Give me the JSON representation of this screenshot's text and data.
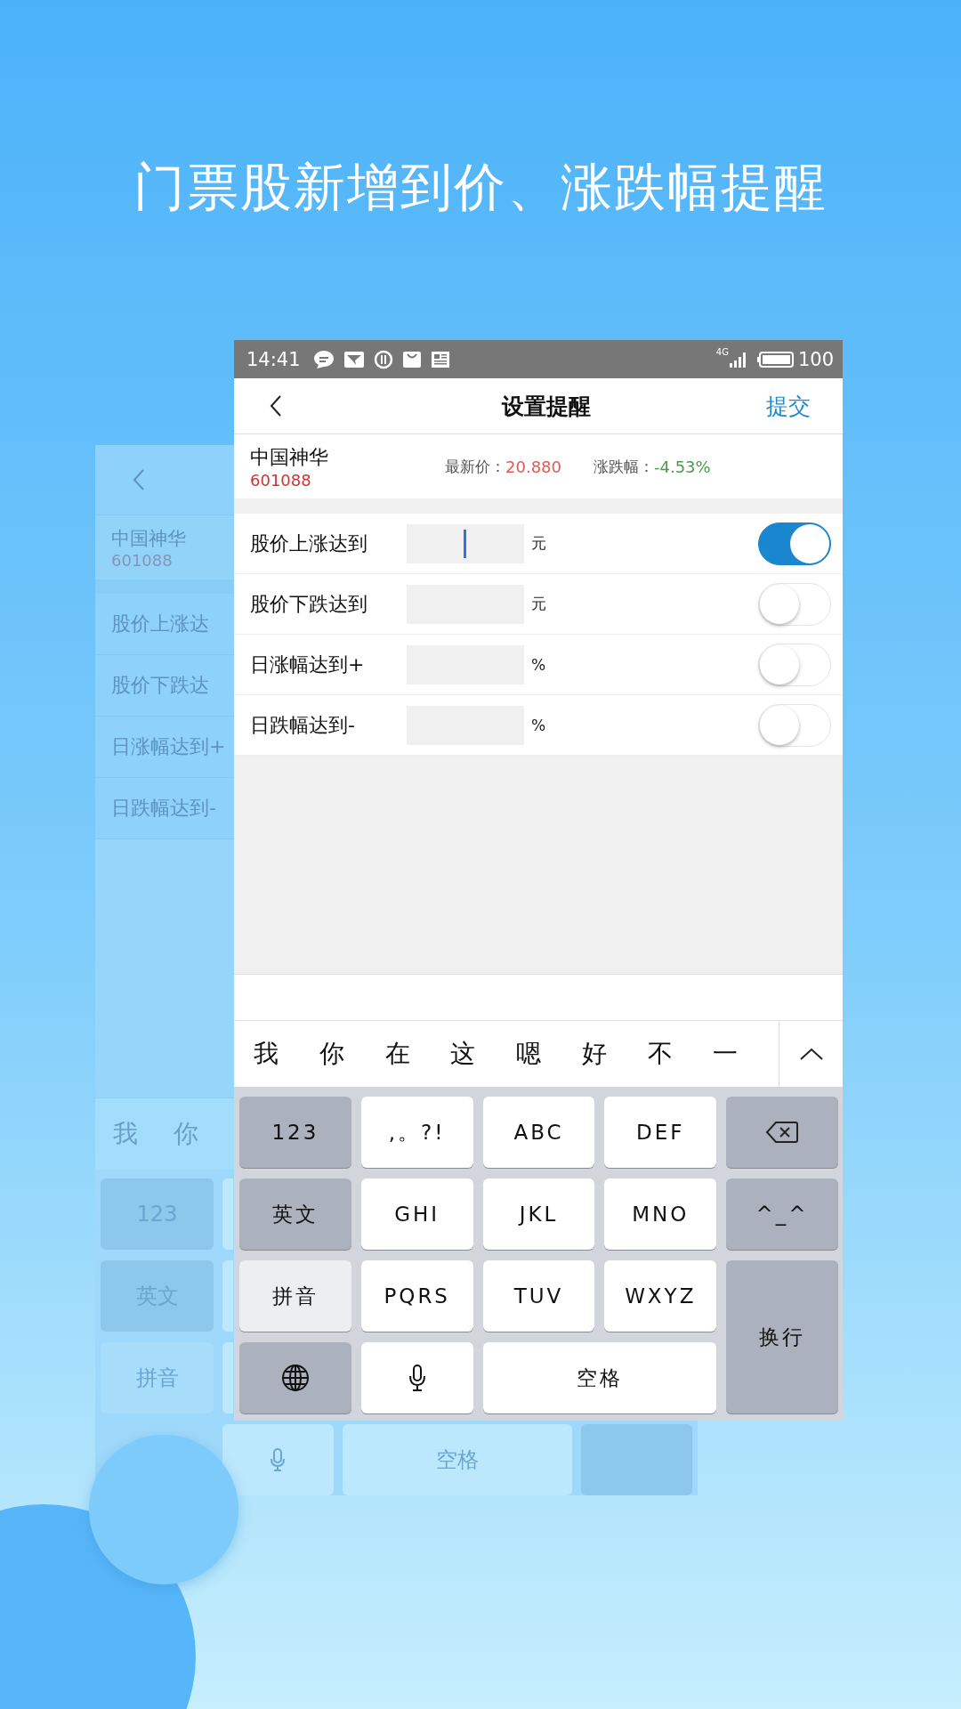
{
  "headline": "门票股新增到价、涨跌幅提醒",
  "background_screen": {
    "stock": {
      "name": "中国神华",
      "code": "601088"
    },
    "rows": [
      "股价上涨达",
      "股价下跌达",
      "日涨幅达到+",
      "日跌幅达到-"
    ],
    "candidates": [
      "我",
      "你"
    ],
    "key_rows": [
      [
        {
          "kind": "function",
          "label": "123"
        },
        {
          "kind": "partial"
        }
      ],
      [
        {
          "kind": "function",
          "label": "英文"
        },
        {
          "kind": "partial"
        }
      ],
      [
        {
          "kind": "active",
          "label": "拼音"
        },
        {
          "kind": "partial"
        }
      ],
      [
        {
          "kind": "gap"
        },
        {
          "kind": "mic"
        },
        {
          "kind": "space",
          "label": "空格"
        },
        {
          "kind": "function"
        }
      ]
    ]
  },
  "screen": {
    "status_bar": {
      "time": "14:41",
      "network": "4G",
      "battery": "100"
    },
    "header": {
      "title": "设置提醒",
      "action": "提交"
    },
    "stock": {
      "name": "中国神华",
      "code": "601088",
      "price_label": "最新价：",
      "price": "20.880",
      "change_label": "涨跌幅：",
      "change": "-4.53%"
    },
    "alerts": [
      {
        "label": "股价上涨达到",
        "unit": "元",
        "focused": true,
        "on": true
      },
      {
        "label": "股价下跌达到",
        "unit": "元",
        "focused": false,
        "on": false
      },
      {
        "label": "日涨幅达到+",
        "unit": "%",
        "focused": false,
        "on": false
      },
      {
        "label": "日跌幅达到-",
        "unit": "%",
        "focused": false,
        "on": false
      }
    ],
    "candidates": [
      "我",
      "你",
      "在",
      "这",
      "嗯",
      "好",
      "不",
      "一"
    ],
    "keys": [
      {
        "kind": "function",
        "label": "123"
      },
      {
        "kind": "char",
        "label": ",。?!"
      },
      {
        "kind": "char",
        "label": "ABC"
      },
      {
        "kind": "char",
        "label": "DEF"
      },
      {
        "kind": "delete"
      },
      {
        "kind": "function",
        "label": "英文"
      },
      {
        "kind": "char",
        "label": "GHI"
      },
      {
        "kind": "char",
        "label": "JKL"
      },
      {
        "kind": "char",
        "label": "MNO"
      },
      {
        "kind": "function",
        "label": "^_^"
      },
      {
        "kind": "active",
        "label": "拼音"
      },
      {
        "kind": "char",
        "label": "PQRS"
      },
      {
        "kind": "char",
        "label": "TUV"
      },
      {
        "kind": "char",
        "label": "WXYZ"
      },
      {
        "kind": "enter",
        "label": "换行"
      },
      {
        "kind": "globe"
      },
      {
        "kind": "mic"
      },
      {
        "kind": "space",
        "label": "空格"
      }
    ]
  }
}
